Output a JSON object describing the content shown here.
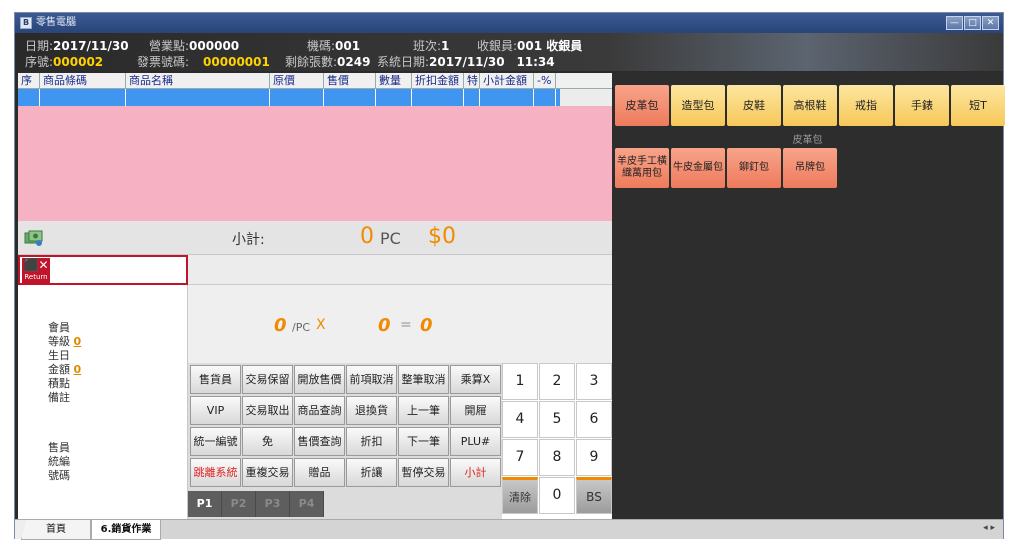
{
  "window": {
    "title": "零售電腦",
    "app_icon": "B",
    "controls": [
      "—",
      "□",
      "✕"
    ]
  },
  "info": {
    "date_label": "日期:",
    "date": "2017/11/30",
    "seq_label": "序號:",
    "seq": "000002",
    "store_label": "營業點:",
    "store": "000000",
    "invoice_label": "發票號碼:",
    "invoice": "00000001",
    "machine_label": "機碼:",
    "machine": "001",
    "remaining_label": "剩餘張數:",
    "remaining": "0249",
    "shift_label": "班次:",
    "shift": "1",
    "sysdate_label": "系統日期:",
    "sysdate": "2017/11/30",
    "time": "11:34",
    "cashier_label": "收銀員:",
    "cashier": "001 收銀員"
  },
  "grid": {
    "columns": [
      "序",
      "商品條碼",
      "商品名稱",
      "原價",
      "售價",
      "數量",
      "折扣金額",
      "特",
      "小計金額",
      "-%"
    ]
  },
  "subtotal": {
    "label": "小計:",
    "qty": "0",
    "unit": "PC",
    "amount": "$0"
  },
  "return": {
    "label": "Return",
    "icon": "return-icon"
  },
  "member": {
    "member_label": "會員",
    "level_label": "等級",
    "level_value": "0",
    "birthday_label": "生日",
    "amount_label": "金額",
    "amount_value": "0",
    "points_label": "積點",
    "note_label": "備註",
    "clerk_label": "售員",
    "taxid_label": "統編",
    "number_label": "號碼"
  },
  "calc": {
    "qty": "0",
    "per": "/PC",
    "times": "X",
    "price": "0",
    "equals": "=",
    "total": "0"
  },
  "functions": [
    [
      "售貨員",
      "交易保留",
      "開放售價",
      "前項取消",
      "整筆取消",
      "乘算X"
    ],
    [
      "VIP",
      "交易取出",
      "商品查詢",
      "退換貨",
      "上一筆",
      "開屜"
    ],
    [
      "統一編號",
      "免",
      "售價查詢",
      "折扣",
      "下一筆",
      "PLU#"
    ],
    [
      "跳離系統",
      "重複交易",
      "贈品",
      "折讓",
      "暫停交易",
      "小計"
    ]
  ],
  "pages": [
    "P1",
    "P2",
    "P3",
    "P4"
  ],
  "keypad": {
    "k1": "1",
    "k2": "2",
    "k3": "3",
    "k4": "4",
    "k5": "5",
    "k6": "6",
    "k7": "7",
    "k8": "8",
    "k9": "9",
    "clear": "清除",
    "k0": "0",
    "bs": "BS"
  },
  "categories": [
    "皮革包",
    "造型包",
    "皮鞋",
    "高根鞋",
    "戒指",
    "手錶",
    "短T"
  ],
  "category_title": "皮革包",
  "products": [
    "羊皮手工橫織萬用包",
    "牛皮金屬包",
    "鉚釘包",
    "吊牌包"
  ],
  "tabs": {
    "home": "首頁",
    "sales": "6.銷貨作業",
    "arrows": "◂ ▸"
  },
  "colors": {
    "grid_body": "#f6b2c2",
    "grid_selected": "#3f95f0",
    "accent_orange": "#f08a00",
    "category_active": "#ee7a5c",
    "category_normal": "#f6c858"
  }
}
